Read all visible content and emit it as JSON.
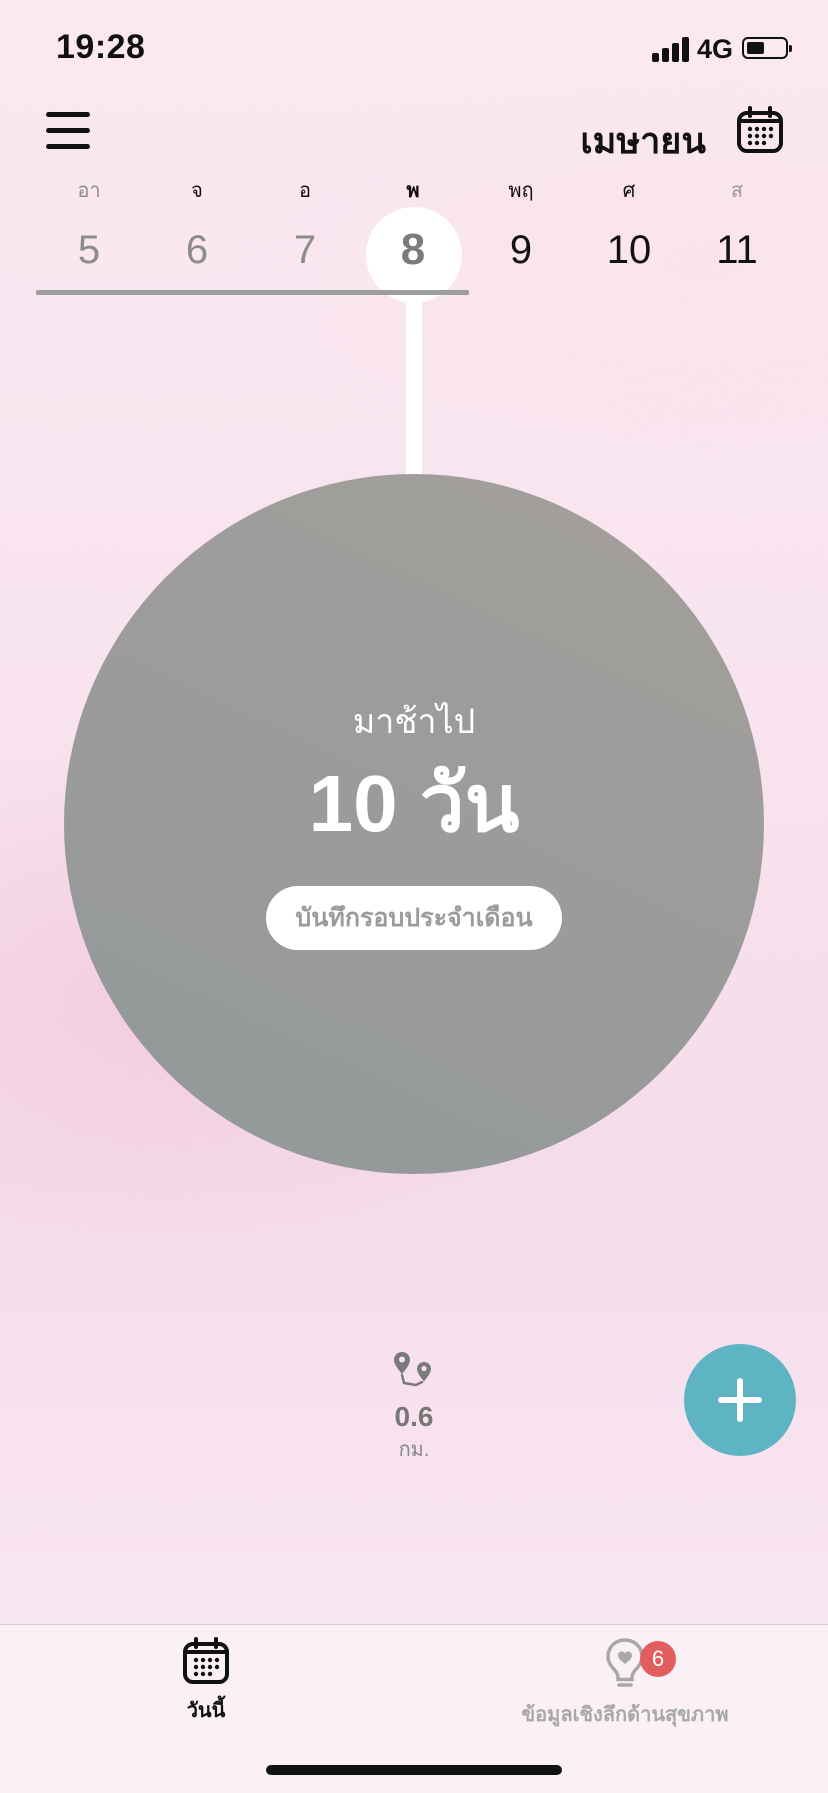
{
  "status_bar": {
    "time": "19:28",
    "network": "4G",
    "battery_level": 0.45
  },
  "header": {
    "month": "เมษายน",
    "menu_icon": "hamburger-icon",
    "calendar_icon": "calendar-icon"
  },
  "week": {
    "days": [
      {
        "weekday": "อา",
        "date": "5",
        "state": "past"
      },
      {
        "weekday": "จ",
        "date": "6",
        "state": "past"
      },
      {
        "weekday": "อ",
        "date": "7",
        "state": "past"
      },
      {
        "weekday": "พ",
        "date": "8",
        "state": "today"
      },
      {
        "weekday": "พฤ",
        "date": "9",
        "state": "future"
      },
      {
        "weekday": "ศ",
        "date": "10",
        "state": "future"
      },
      {
        "weekday": "ส",
        "date": "11",
        "state": "future"
      }
    ]
  },
  "cycle": {
    "status_label": "มาช้าไป",
    "days_late": "10 วัน",
    "log_button": "บันทึกรอบประจำเดือน"
  },
  "distance": {
    "icon": "route-pins-icon",
    "value": "0.6",
    "unit": "กม."
  },
  "fab": {
    "icon": "plus-icon"
  },
  "tabs": {
    "today": {
      "label": "วันนี้",
      "icon": "calendar-icon"
    },
    "insights": {
      "label": "ข้อมูลเชิงลึกด้านสุขภาพ",
      "icon": "lightbulb-heart-icon",
      "badge": "6"
    }
  },
  "colors": {
    "accent": "#5fb4c4",
    "badge": "#e25d5d",
    "circle": "#9b9b9a"
  }
}
